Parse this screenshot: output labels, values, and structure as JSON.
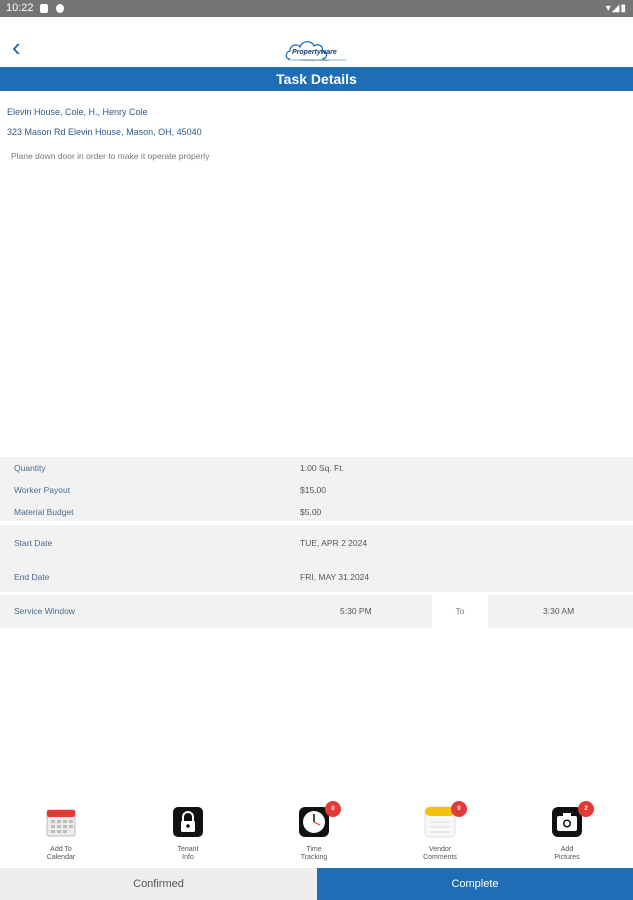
{
  "status_bar": {
    "time": "10:22"
  },
  "header": {
    "back_label": "<",
    "logo_brand": "Propertyware",
    "logo_tagline": "A RealPage Company",
    "title": "Task Details"
  },
  "task": {
    "address_line1": "Elevin House, Cole, H., Henry Cole",
    "address_line2": "323 Mason Rd  Elevin House, Mason, OH, 45040",
    "description": "Plane down door in order to make it operate properly"
  },
  "details": [
    {
      "label": "Quantity",
      "value": "1.00 Sq. Ft."
    },
    {
      "label": "Worker Payout",
      "value": "$15.00"
    },
    {
      "label": "Material Budget",
      "value": "$5.00"
    }
  ],
  "dates": {
    "start_label": "Start Date",
    "start_value": "TUE, APR 2  2024",
    "end_label": "End Date",
    "end_value": "FRI, MAY 31  2024"
  },
  "service_window": {
    "label": "Service Window",
    "from": "5:30 PM",
    "to_label": "To",
    "until": "3:30 AM"
  },
  "toolbar": [
    {
      "line1": "Add To",
      "line2": "Calendar",
      "icon": "calendar-icon",
      "badge": ""
    },
    {
      "line1": "Tenant",
      "line2": "Info",
      "icon": "lock-icon",
      "badge": ""
    },
    {
      "line1": "Time",
      "line2": "Tracking",
      "icon": "clock-icon",
      "badge": "0"
    },
    {
      "line1": "Vendor",
      "line2": "Comments",
      "icon": "notes-icon",
      "badge": "0"
    },
    {
      "line1": "Add",
      "line2": "Pictures",
      "icon": "camera-icon",
      "badge": "2"
    }
  ],
  "actions": {
    "confirmed": "Confirmed",
    "complete": "Complete"
  },
  "colors": {
    "primary": "#1f6db5",
    "badge": "#e53935"
  }
}
